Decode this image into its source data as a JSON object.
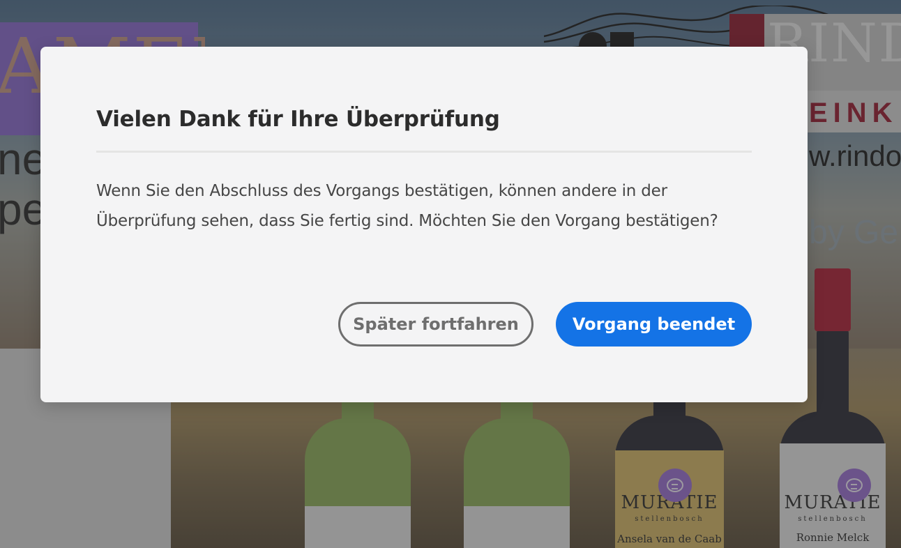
{
  "background": {
    "purple_banner_text": "AMERICA",
    "left_text_line1": "ne",
    "left_text_line2": "pe",
    "brand_name": "RINDC",
    "brand_sub": "EINK",
    "brand_url": "w.rindo",
    "brand_by": "by Ge",
    "bottles": [
      {
        "brand": "",
        "sub": "",
        "name": ""
      },
      {
        "brand": "",
        "sub": "",
        "name": ""
      },
      {
        "brand": "MURATIE",
        "sub": "stellenbosch",
        "name": "Ansela van de Caab"
      },
      {
        "brand": "MURATIE",
        "sub": "stellenbosch",
        "name": "Ronnie Melck"
      }
    ]
  },
  "dialog": {
    "title": "Vielen Dank für Ihre Überprüfung",
    "body": "Wenn Sie den Abschluss des Vorgangs bestätigen, können andere in der Überprüfung sehen, dass Sie fertig sind. Möchten Sie den Vorgang bestätigen?",
    "secondary_button": "Später fortfahren",
    "primary_button": "Vorgang beendet"
  },
  "colors": {
    "primary_button": "#1473e6",
    "secondary_button_border": "#6e6e6e",
    "dialog_background": "#f4f4f5",
    "comment_pin": "#9b6fd4"
  },
  "icons": [
    "comment-pin-icon",
    "comment-pin-icon"
  ]
}
